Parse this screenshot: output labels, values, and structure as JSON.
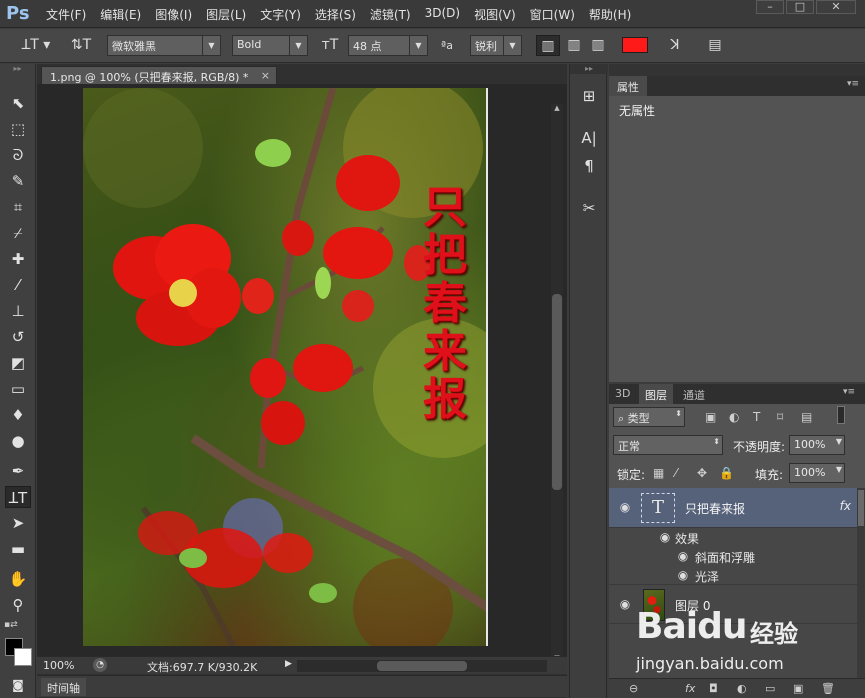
{
  "app": {
    "logo": "Ps"
  },
  "menubar": {
    "items": [
      "文件(F)",
      "编辑(E)",
      "图像(I)",
      "图层(L)",
      "文字(Y)",
      "选择(S)",
      "滤镜(T)",
      "3D(D)",
      "视图(V)",
      "窗口(W)",
      "帮助(H)"
    ],
    "window_buttons": [
      "–",
      "□",
      "✕"
    ]
  },
  "options": {
    "font_family": "微软雅黑",
    "font_style": "Bold",
    "font_size": "48 点",
    "aa_label": "ªa",
    "antialias": "锐利",
    "text_color": "#ff1a1a"
  },
  "document": {
    "tab_title": "1.png @ 100% (只把春来报, RGB/8) *",
    "tab_close": "×",
    "vertical_text": "只把春来报"
  },
  "status": {
    "zoom": "100%",
    "doc_size": "文档:697.7 K/930.2K"
  },
  "timeline": {
    "label": "时间轴"
  },
  "properties": {
    "tab": "属性",
    "body": "无属性"
  },
  "layers_panel": {
    "tabs": [
      "3D",
      "图层",
      "通道"
    ],
    "filter_kind": "类型",
    "blend_mode": "正常",
    "opacity_label": "不透明度:",
    "opacity_value": "100%",
    "lock_label": "锁定:",
    "fill_label": "填充:",
    "fill_value": "100%",
    "text_layer": {
      "thumb": "T",
      "name": "只把春来报",
      "fx": "fx",
      "effects_label": "效果",
      "effects": [
        "斜面和浮雕",
        "光泽"
      ]
    },
    "bg_layer": {
      "name": "图层 0"
    },
    "bottom_icons": [
      "⊖",
      "fx",
      "◘",
      "◐",
      "▭",
      "▣",
      "🗑"
    ]
  },
  "watermark": {
    "logo": "Baidu",
    "jingyan": "经验",
    "url": "jingyan.baidu.com"
  }
}
